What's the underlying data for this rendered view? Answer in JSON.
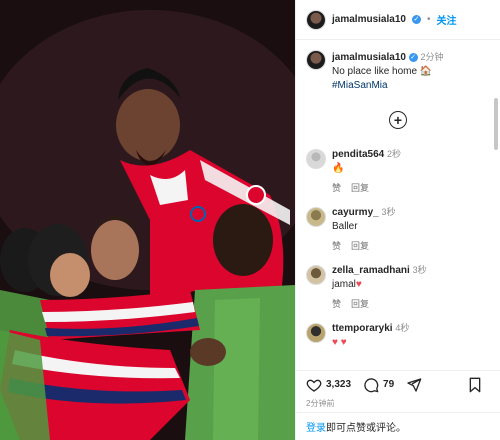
{
  "post": {
    "username": "jamalmusiala10",
    "follow_label": "关注",
    "caption_time": "2分钟",
    "caption_text": "No place like home",
    "caption_emoji": "🏠",
    "hashtag": "#MiaSanMia",
    "load_more_label": "+"
  },
  "comments": [
    {
      "username": "pendita564",
      "time": "2秒",
      "text": "🔥",
      "like_label": "赞",
      "reply_label": "回复",
      "avatar": "grey"
    },
    {
      "username": "cayurmy_",
      "time": "3秒",
      "text": "Baller",
      "like_label": "赞",
      "reply_label": "回复",
      "avatar": "c1"
    },
    {
      "username": "zella_ramadhani",
      "time": "3秒",
      "text": "jamal",
      "heart": "♥",
      "like_label": "赞",
      "reply_label": "回复",
      "avatar": "c2"
    },
    {
      "username": "ttemporaryki",
      "time": "4秒",
      "text": "",
      "heart": "♥ ♥",
      "avatar": "c3"
    }
  ],
  "stats": {
    "likes": "3,323",
    "comments": "79",
    "time_ago": "2分钟前"
  },
  "login": {
    "link": "登录",
    "rest": "即可点赞或评论。"
  },
  "colors": {
    "accent": "#0095f6",
    "heart": "#ed4956",
    "bayern_red": "#dc052d"
  },
  "icons": [
    "verified-icon",
    "add-circle-icon",
    "heart-icon",
    "comment-icon",
    "share-icon",
    "bookmark-icon"
  ]
}
